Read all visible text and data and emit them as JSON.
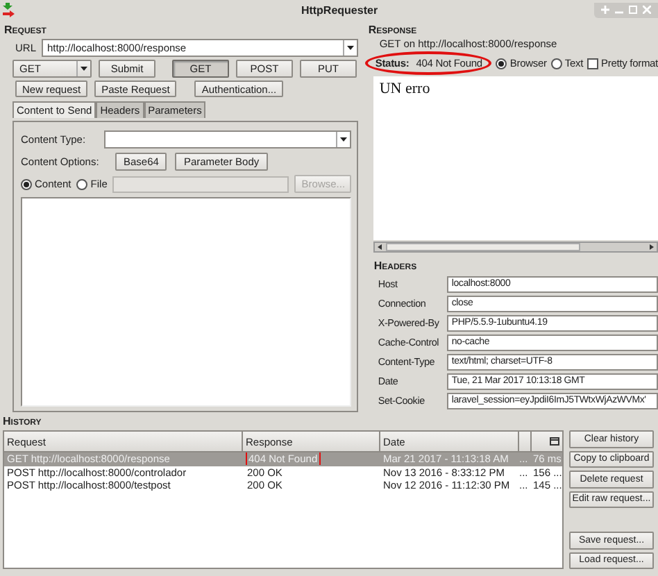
{
  "window": {
    "title": "HttpRequester"
  },
  "request": {
    "heading": "Request",
    "url_label": "URL",
    "url": "http://localhost:8000/response",
    "method": "GET",
    "buttons_row1": [
      {
        "label": "Submit",
        "pressed": false
      },
      {
        "label": "GET",
        "pressed": true
      },
      {
        "label": "POST",
        "pressed": false
      },
      {
        "label": "PUT",
        "pressed": false
      }
    ],
    "buttons_row2": [
      "New request",
      "Paste Request",
      "Authentication..."
    ],
    "tabs": [
      {
        "label": "Content to Send",
        "selected": true
      },
      {
        "label": "Headers",
        "selected": false
      },
      {
        "label": "Parameters",
        "selected": false
      }
    ],
    "content_type_label": "Content Type:",
    "content_options_label": "Content Options:",
    "option_buttons": [
      "Base64",
      "Parameter Body"
    ],
    "source": [
      {
        "label": "Content",
        "selected": true
      },
      {
        "label": "File",
        "selected": false
      }
    ],
    "browse": {
      "label": "Browse...",
      "disabled": true
    }
  },
  "response": {
    "heading": "Response",
    "summary": "GET on http://localhost:8000/response",
    "status_label": "Status:",
    "status": "404 Not Found",
    "status_annotated": true,
    "view": [
      {
        "label": "Browser",
        "selected": true
      },
      {
        "label": "Text",
        "selected": false
      }
    ],
    "pretty_format": {
      "label": "Pretty format",
      "checked": false
    },
    "body": "UN erro"
  },
  "headers": {
    "heading": "Headers",
    "rows": [
      {
        "name": "Host",
        "value": "localhost:8000"
      },
      {
        "name": "Connection",
        "value": "close"
      },
      {
        "name": "X-Powered-By",
        "value": "PHP/5.5.9-1ubuntu4.19"
      },
      {
        "name": "Cache-Control",
        "value": "no-cache"
      },
      {
        "name": "Content-Type",
        "value": "text/html; charset=UTF-8"
      },
      {
        "name": "Date",
        "value": "Tue, 21 Mar 2017 10:13:18 GMT"
      },
      {
        "name": "Set-Cookie",
        "value": "laravel_session=eyJpdiI6ImJ5TWtxWjAzWVMx'"
      }
    ]
  },
  "history": {
    "heading": "History",
    "columns": [
      "Request",
      "Response",
      "Date"
    ],
    "rows": [
      {
        "request": "GET http://localhost:8000/response",
        "response": "404 Not Found",
        "date": "Mar 21 2017 - 11:13:18 AM",
        "column_4": "...",
        "column_5": "76 ms",
        "selected": true,
        "annotated": true
      },
      {
        "request": "POST http://localhost:8000/controlador",
        "response": "200 OK",
        "date": "Nov 13 2016 - 8:33:12 PM",
        "column_4": "...",
        "column_5": "156 ...",
        "selected": false,
        "annotated": false
      },
      {
        "request": "POST http://localhost:8000/testpost",
        "response": "200 OK",
        "date": "Nov 12 2016 - 11:12:30 PM",
        "column_4": "...",
        "column_5": "145 ...",
        "selected": false,
        "annotated": false
      }
    ],
    "buttons": [
      "Clear history",
      "Copy to clipboard",
      "Delete request",
      "Edit raw request..."
    ],
    "file_buttons": [
      "Save request...",
      "Load request..."
    ]
  }
}
